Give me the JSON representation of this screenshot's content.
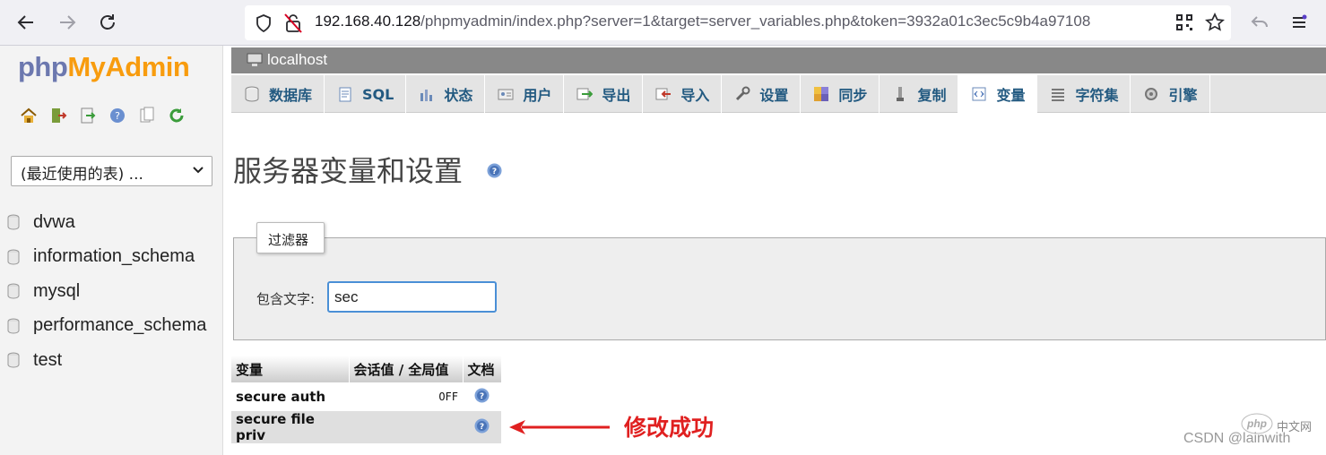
{
  "browser": {
    "url_host": "192.168.40.128",
    "url_path": "/phpmyadmin/index.php?server=1&target=server_variables.php&token=3932a01c3ec5c9b4a97108"
  },
  "sidebar": {
    "logo_php": "php",
    "logo_myadmin": "MyAdmin",
    "recent_tables": "(最近使用的表) ...",
    "databases": [
      "dvwa",
      "information_schema",
      "mysql",
      "performance_schema",
      "test"
    ]
  },
  "server": {
    "name": "localhost"
  },
  "tabs": [
    {
      "label": "数据库",
      "icon": "database-icon"
    },
    {
      "label": "SQL",
      "icon": "sql-icon"
    },
    {
      "label": "状态",
      "icon": "status-icon"
    },
    {
      "label": "用户",
      "icon": "users-icon"
    },
    {
      "label": "导出",
      "icon": "export-icon"
    },
    {
      "label": "导入",
      "icon": "import-icon"
    },
    {
      "label": "设置",
      "icon": "settings-icon"
    },
    {
      "label": "同步",
      "icon": "sync-icon"
    },
    {
      "label": "复制",
      "icon": "replication-icon"
    },
    {
      "label": "变量",
      "icon": "variables-icon",
      "active": true
    },
    {
      "label": "字符集",
      "icon": "charset-icon"
    },
    {
      "label": "引擎",
      "icon": "engine-icon"
    }
  ],
  "page": {
    "title": "服务器变量和设置",
    "filter_legend": "过滤器",
    "filter_label": "包含文字:",
    "filter_value": "sec"
  },
  "table": {
    "headers": [
      "变量",
      "会话值 / 全局值",
      "文档"
    ],
    "rows": [
      {
        "name": "secure auth",
        "value": "OFF"
      },
      {
        "name": "secure file priv",
        "value": ""
      }
    ]
  },
  "annotation": {
    "text": "修改成功",
    "color": "#e02020"
  },
  "watermark": {
    "php": "php",
    "cn": "中文网",
    "csdn": "CSDN @lainwith"
  },
  "colors": {
    "link": "#235a81",
    "accent_orange": "#f89c0e",
    "logo_blue": "#6c78af"
  }
}
